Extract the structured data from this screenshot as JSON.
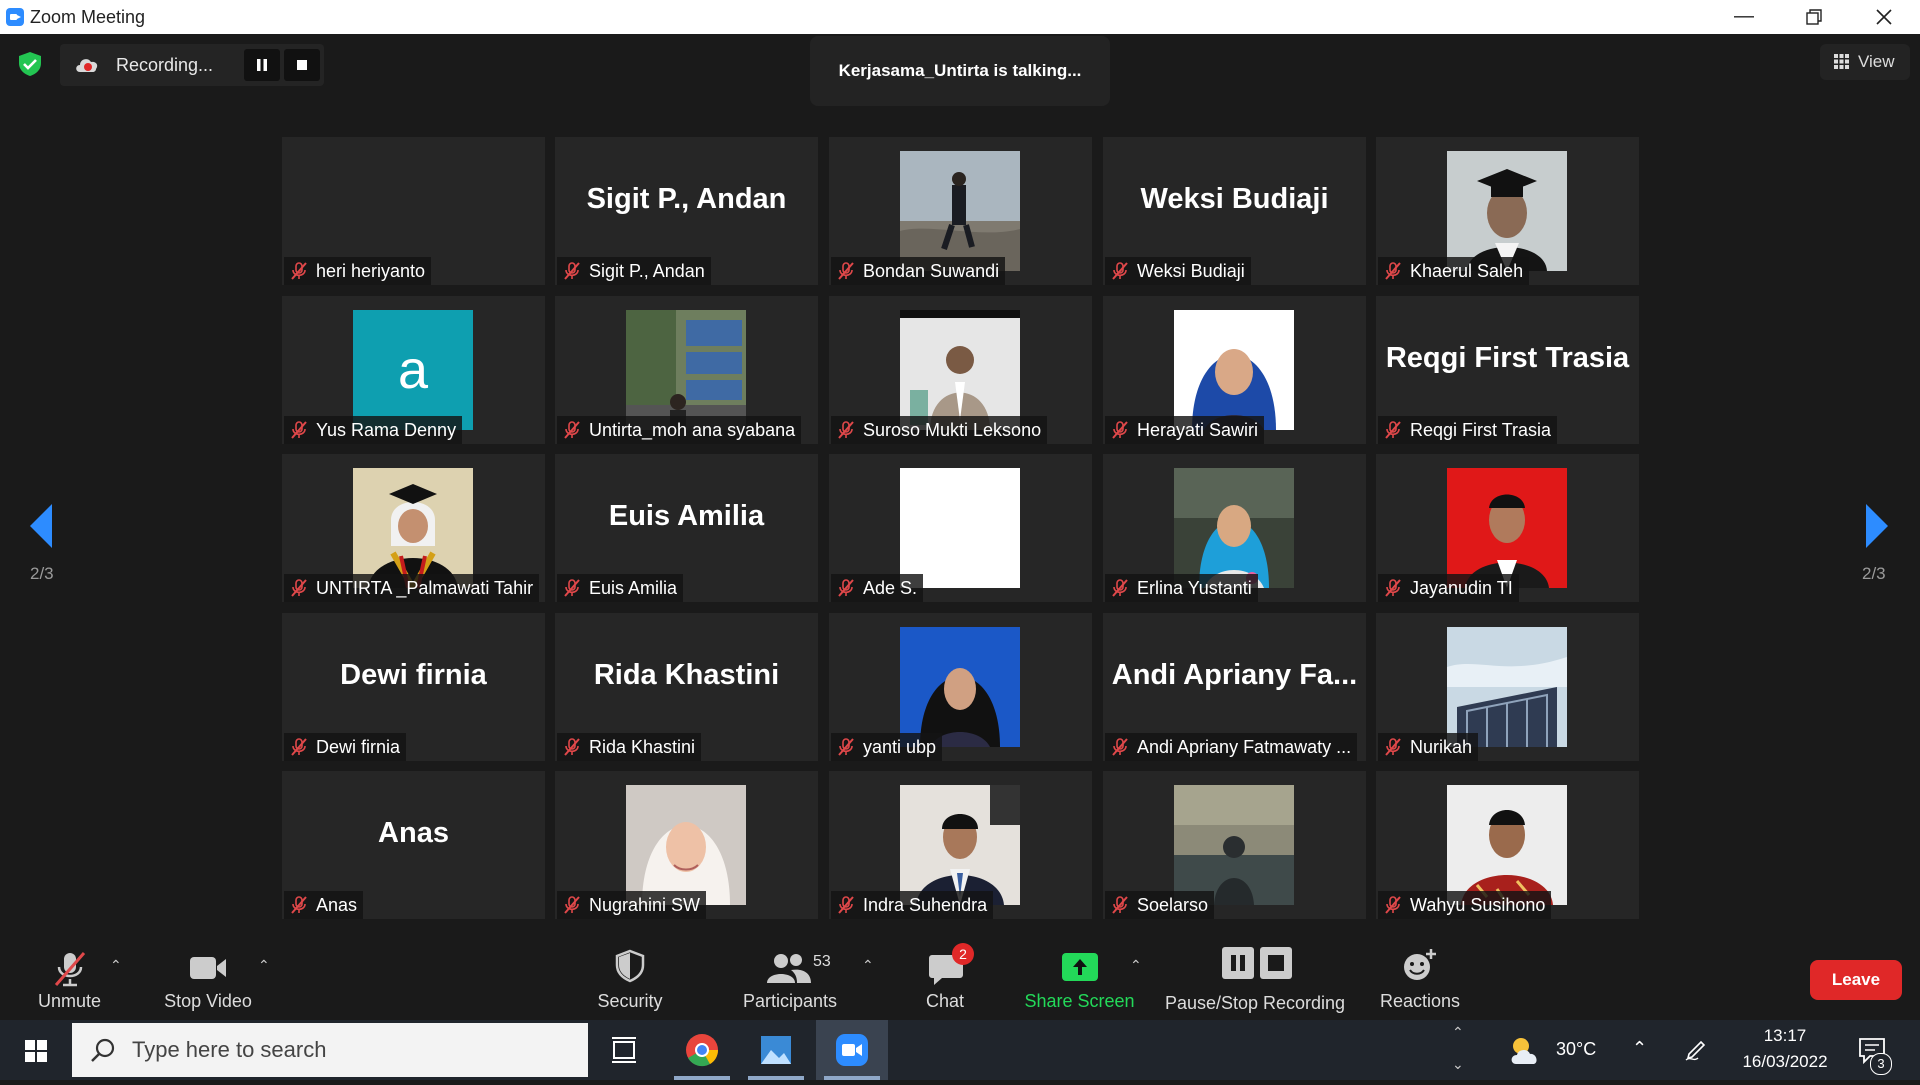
{
  "window": {
    "title": "Zoom Meeting"
  },
  "top": {
    "recording_label": "Recording...",
    "talking": "Kerjasama_Untirta is talking...",
    "view_label": "View"
  },
  "nav": {
    "page_left": "2/3",
    "page_right": "2/3"
  },
  "tiles": [
    {
      "name": "heri heriyanto",
      "big": "",
      "photo": "dark"
    },
    {
      "name": "Sigit P., Andan",
      "big": "Sigit P., Andan",
      "photo": ""
    },
    {
      "name": "Bondan Suwandi",
      "big": "",
      "photo": "beach"
    },
    {
      "name": "Weksi Budiaji",
      "big": "Weksi Budiaji",
      "photo": ""
    },
    {
      "name": "Khaerul Saleh",
      "big": "",
      "photo": "gradcap"
    },
    {
      "name": "Yus Rama Denny",
      "big": "",
      "photo": "avatar-a"
    },
    {
      "name": "Untirta_moh ana syabana",
      "big": "",
      "photo": "street"
    },
    {
      "name": "Suroso Mukti Leksono",
      "big": "",
      "photo": "suit-grey"
    },
    {
      "name": "Herayati Sawiri",
      "big": "",
      "photo": "hijab-blue"
    },
    {
      "name": "Reqgi First Trasia",
      "big": "Reqgi First Trasia",
      "photo": ""
    },
    {
      "name": "UNTIRTA _Palmawati Tahir",
      "big": "",
      "photo": "graduation"
    },
    {
      "name": "Euis Amilia",
      "big": "Euis Amilia",
      "photo": ""
    },
    {
      "name": "Ade S.",
      "big": "",
      "photo": "white"
    },
    {
      "name": "Erlina Yustanti",
      "big": "",
      "photo": "hijab-outdoor"
    },
    {
      "name": "Jayanudin TI",
      "big": "",
      "photo": "red-bg"
    },
    {
      "name": "Dewi firnia",
      "big": "Dewi firnia",
      "photo": ""
    },
    {
      "name": "Rida Khastini",
      "big": "Rida Khastini",
      "photo": ""
    },
    {
      "name": "yanti ubp",
      "big": "",
      "photo": "hijab-dark"
    },
    {
      "name": "Andi Apriany Fatmawaty ...",
      "big": "Andi Apriany Fa...",
      "photo": ""
    },
    {
      "name": "Nurikah",
      "big": "",
      "photo": "building"
    },
    {
      "name": "Anas",
      "big": "Anas",
      "photo": ""
    },
    {
      "name": "Nugrahini SW",
      "big": "",
      "photo": "hijab-white"
    },
    {
      "name": "Indra Suhendra",
      "big": "",
      "photo": "suit-dark"
    },
    {
      "name": "Soelarso",
      "big": "",
      "photo": "sunset"
    },
    {
      "name": "Wahyu Susihono",
      "big": "",
      "photo": "batik"
    }
  ],
  "toolbar": {
    "unmute": "Unmute",
    "stop_video": "Stop Video",
    "security": "Security",
    "participants": "Participants",
    "participants_count": "53",
    "chat": "Chat",
    "chat_badge": "2",
    "share_screen": "Share Screen",
    "pause_stop_recording": "Pause/Stop Recording",
    "reactions": "Reactions",
    "leave": "Leave"
  },
  "taskbar": {
    "search_placeholder": "Type here to search",
    "temperature": "30°C",
    "time": "13:17",
    "date": "16/03/2022",
    "notifications": "3"
  },
  "colors": {
    "accent": "#2d8cff",
    "leave": "#e02828",
    "share": "#23d959",
    "muted": "#e0484a"
  }
}
